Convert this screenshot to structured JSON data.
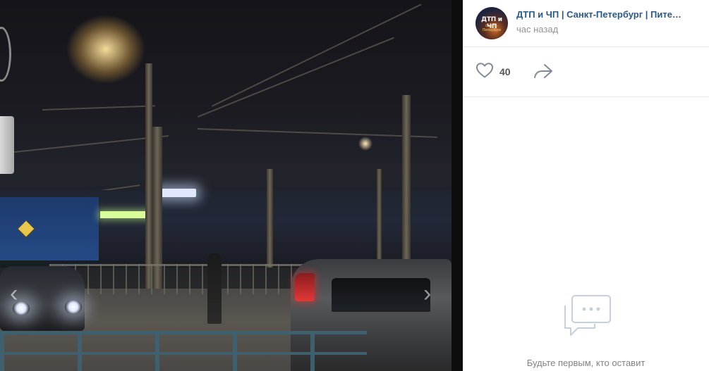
{
  "post": {
    "group_name": "ДТП и ЧП | Санкт-Петербург | Пите…",
    "time": "час назад",
    "avatar_text": "ДТП и ЧП",
    "avatar_subtext": "Санкт-Петербург"
  },
  "actions": {
    "like_count": "40",
    "like_icon": "heart-icon",
    "share_icon": "share-arrow-icon"
  },
  "comments": {
    "empty_text": "Будьте первым, кто оставит",
    "icon": "comment-bubble-icon"
  },
  "viewer": {
    "prev_arrow": "‹",
    "next_arrow": "›"
  }
}
